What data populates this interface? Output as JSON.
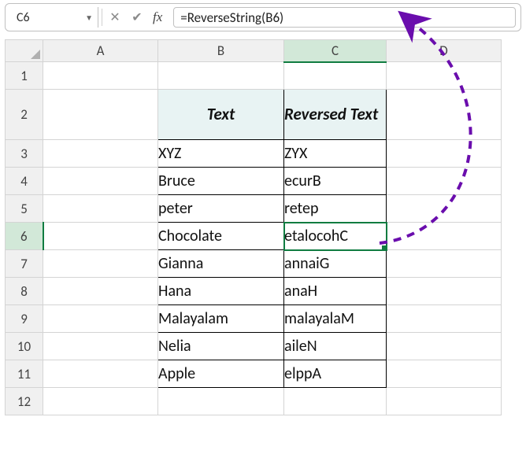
{
  "formula_bar": {
    "cell_ref": "C6",
    "formula": "=ReverseString(B6)"
  },
  "columns": [
    "A",
    "B",
    "C",
    "D"
  ],
  "rows": [
    "1",
    "2",
    "3",
    "4",
    "5",
    "6",
    "7",
    "8",
    "9",
    "10",
    "11",
    "12"
  ],
  "headers": {
    "text": "Text",
    "reversed": "Reversed Text"
  },
  "selection": {
    "col": "C",
    "row": "6"
  },
  "chart_data": {
    "type": "table",
    "title": "",
    "columns": [
      "Text",
      "Reversed Text"
    ],
    "rows": [
      [
        "XYZ",
        "ZYX"
      ],
      [
        "Bruce",
        "ecurB"
      ],
      [
        "peter",
        "retep"
      ],
      [
        "Chocolate",
        "etalocohC"
      ],
      [
        "Gianna",
        "annaiG"
      ],
      [
        "Hana",
        "anaH"
      ],
      [
        "Malayalam",
        "malayalaM"
      ],
      [
        "Nelia",
        "aileN"
      ],
      [
        "Apple",
        "elppA"
      ]
    ]
  },
  "colors": {
    "accent": "#107c41",
    "arrow": "#6a0dad"
  }
}
